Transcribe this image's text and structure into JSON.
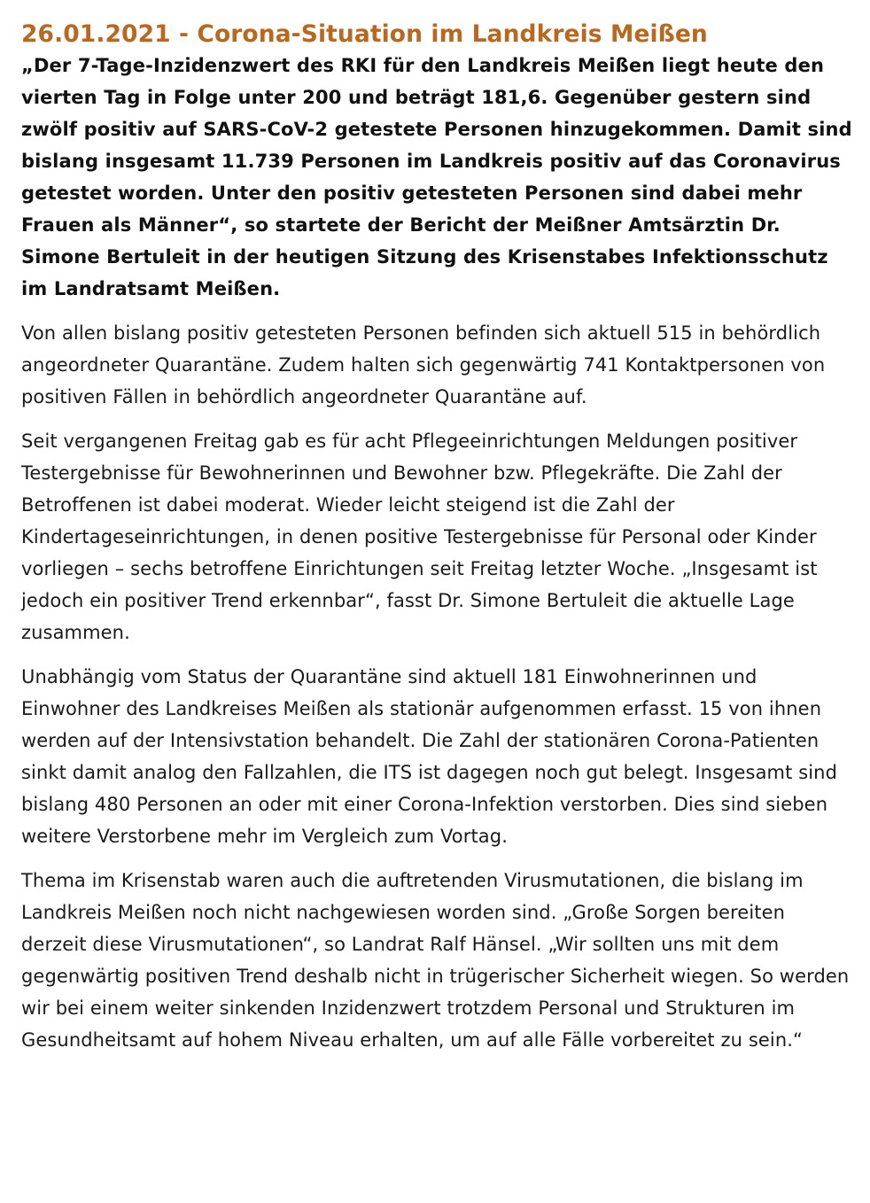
{
  "article": {
    "headline": "26.01.2021 - Corona-Situation im Landkreis Meißen",
    "lead": "„Der 7-Tage-Inzidenzwert des RKI für den Landkreis Meißen liegt heute den vierten Tag in Folge unter 200 und beträgt 181,6. Gegenüber gestern sind zwölf positiv auf SARS-CoV-2 getestete Personen hinzugekommen. Damit sind bislang insgesamt 11.739 Personen im Landkreis positiv auf das Coronavirus getestet worden. Unter den positiv getesteten Personen sind dabei mehr Frauen als Männer“, so startete der Bericht der Meißner Amtsärztin Dr. Simone Bertuleit in der heutigen Sitzung des Krisenstabes Infektionsschutz im Landratsamt Meißen.",
    "paragraphs": [
      "Von allen bislang positiv getesteten Personen befinden sich aktuell 515 in behördlich angeordneter Quarantäne. Zudem halten sich gegenwärtig 741 Kontaktpersonen von positiven Fällen in behördlich angeordneter Quarantäne auf.",
      "Seit vergangenen Freitag gab es für acht Pflegeeinrichtungen Meldungen positiver Testergebnisse für Bewohnerinnen und Bewohner bzw. Pflegekräfte. Die Zahl der Betroffenen ist dabei moderat. Wieder leicht steigend ist die Zahl der Kindertageseinrichtungen, in denen positive Testergebnisse für Personal oder Kinder vorliegen – sechs betroffene Einrichtungen seit Freitag letzter Woche. „Insgesamt ist jedoch ein positiver Trend erkennbar“, fasst Dr. Simone Bertuleit die aktuelle Lage zusammen.",
      "Unabhängig vom Status der Quarantäne sind aktuell 181 Einwohnerinnen und Einwohner des Landkreises Meißen als stationär aufgenommen erfasst. 15 von ihnen werden auf der Intensivstation behandelt. Die Zahl der stationären Corona-Patienten sinkt damit analog den Fallzahlen, die ITS ist dagegen noch gut belegt. Insgesamt sind bislang 480 Personen an oder mit einer Corona-Infektion verstorben. Dies sind sieben weitere Verstorbene mehr im Vergleich zum Vortag.",
      "Thema im Krisenstab waren auch die auftretenden Virusmutationen, die bislang im Landkreis Meißen noch nicht nachgewiesen worden sind. „Große Sorgen bereiten derzeit diese Virusmutationen“, so Landrat Ralf Hänsel. „Wir sollten uns mit dem gegenwärtig positiven Trend deshalb nicht in trügerischer Sicherheit wiegen. So werden wir bei einem weiter sinkenden Inzidenzwert trotzdem Personal und Strukturen im Gesundheitsamt auf hohem Niveau erhalten, um auf alle Fälle vorbereitet zu sein.“"
    ]
  },
  "colors": {
    "headline": "#b8691f",
    "text": "#111111",
    "background": "#ffffff"
  }
}
